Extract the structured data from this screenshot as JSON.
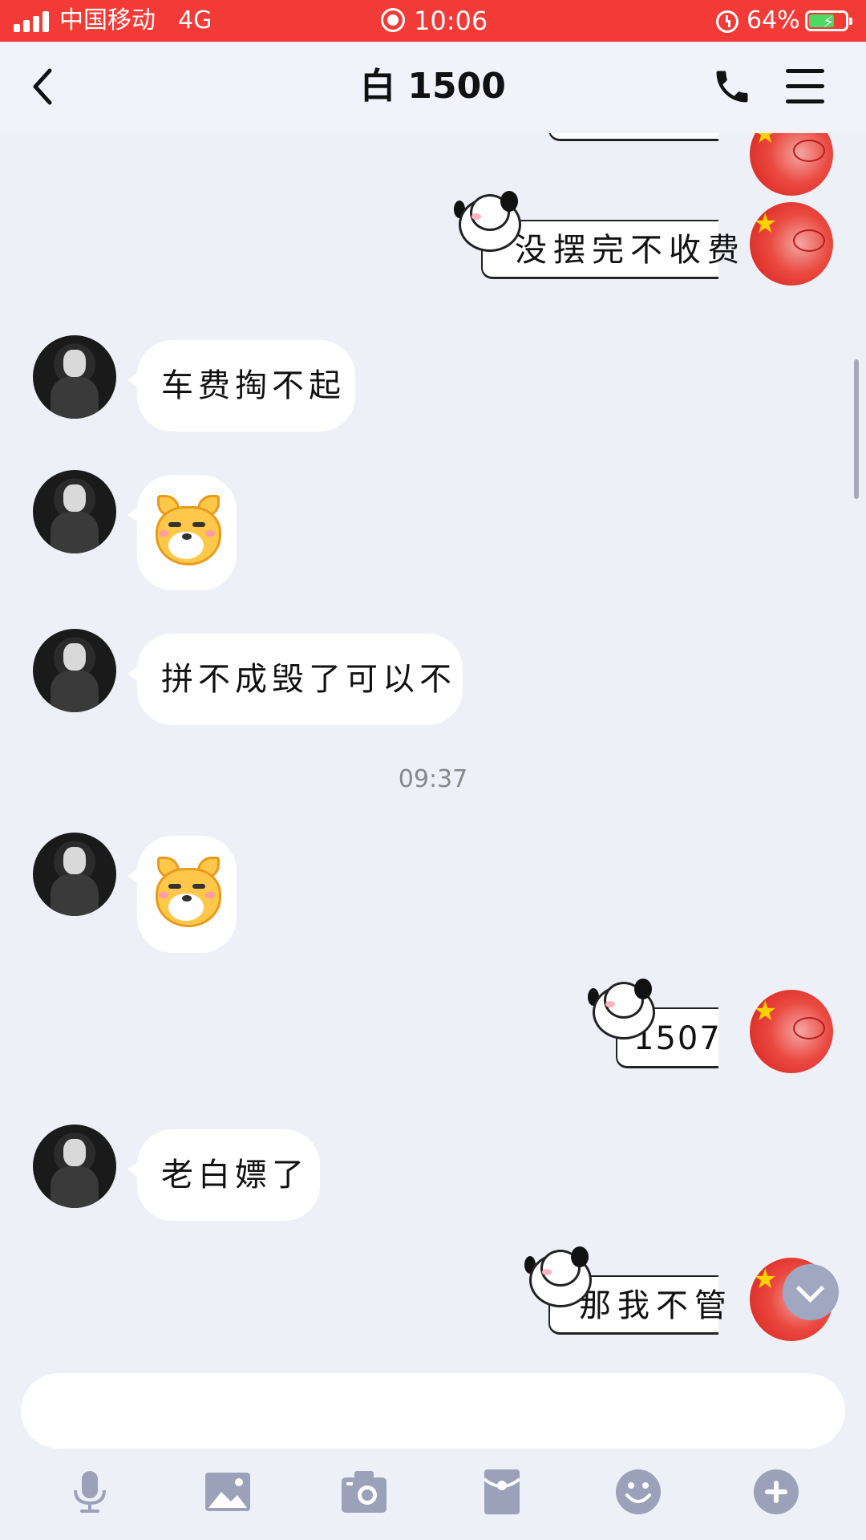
{
  "status_bar": {
    "carrier": "中国移动",
    "network": "4G",
    "time": "10:06",
    "battery": "64%",
    "battery_level": 0.64
  },
  "header": {
    "title": "白 1500",
    "back_icon": "chevron-left-icon",
    "call_icon": "phone-icon",
    "menu_icon": "hamburger-menu-icon"
  },
  "messages": [
    {
      "side": "right",
      "text": "没摆完不收费"
    },
    {
      "side": "left",
      "text": "车费掏不起"
    },
    {
      "side": "left",
      "type": "sticker",
      "sticker": "shiba-face-sticker"
    },
    {
      "side": "left",
      "text": "拼不成毁了可以不"
    },
    {
      "type": "timestamp",
      "text": "09:37"
    },
    {
      "side": "left",
      "type": "sticker",
      "sticker": "shiba-face-sticker"
    },
    {
      "side": "right",
      "text": "1507"
    },
    {
      "side": "left",
      "text": "老白嫖了"
    },
    {
      "side": "right",
      "text": "那我不管"
    }
  ],
  "composer": {
    "input_value": "",
    "icons": [
      "microphone-icon",
      "image-icon",
      "camera-icon",
      "red-packet-icon",
      "emoji-icon",
      "plus-icon"
    ]
  },
  "colors": {
    "status_bar": "#f23a36",
    "background": "#eef0f8",
    "icon_gray": "#9aa1b9"
  }
}
